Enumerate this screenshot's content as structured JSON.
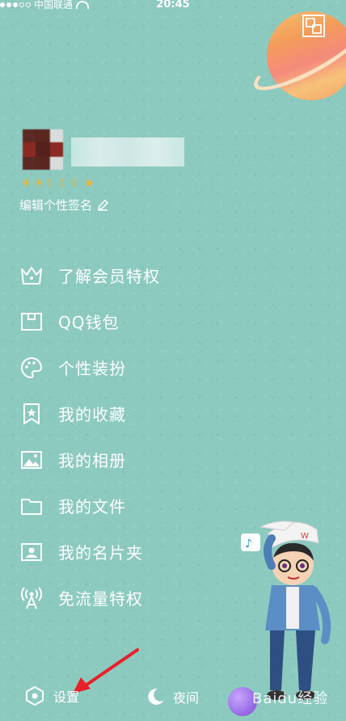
{
  "status_bar": {
    "carrier": "中国联通",
    "time": "20:45"
  },
  "profile": {
    "level_icons": [
      "sun",
      "sun",
      "moon",
      "moon",
      "moon",
      "star"
    ],
    "signature": "编辑个性签名"
  },
  "menu": [
    {
      "label": "了解会员特权",
      "icon": "crown-icon"
    },
    {
      "label": "QQ钱包",
      "icon": "wallet-icon"
    },
    {
      "label": "个性装扮",
      "icon": "palette-icon"
    },
    {
      "label": "我的收藏",
      "icon": "bookmark-icon"
    },
    {
      "label": "我的相册",
      "icon": "photo-icon"
    },
    {
      "label": "我的文件",
      "icon": "folder-icon"
    },
    {
      "label": "我的名片夹",
      "icon": "contact-card-icon"
    },
    {
      "label": "免流量特权",
      "icon": "signal-tower-icon"
    }
  ],
  "bottom": {
    "settings": "设置",
    "night": "夜间"
  },
  "watermark": "Baidu经验",
  "colors": {
    "background": "#8ccac0",
    "annotation_arrow": "#e8202a",
    "level_gold": "#f5b42a"
  }
}
